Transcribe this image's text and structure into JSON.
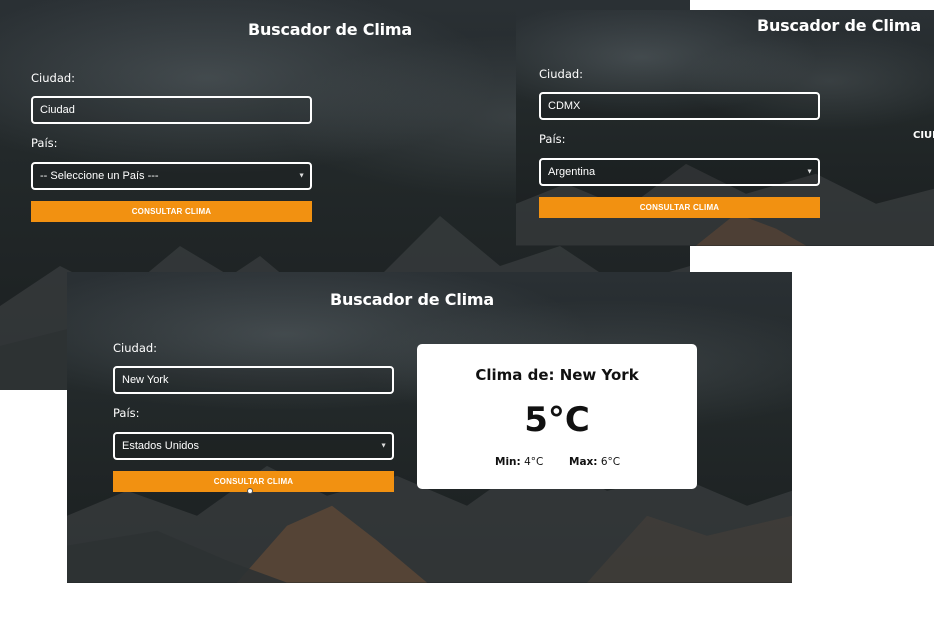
{
  "app": {
    "title": "Buscador de Clima",
    "city_label": "Ciudad:",
    "country_label": "País:",
    "button_label": "CONSULTAR CLIMA"
  },
  "screens": [
    {
      "city_value": "",
      "city_placeholder": "Ciudad",
      "country_value": "-- Seleccione un País ---"
    },
    {
      "city_value": "CDMX",
      "country_value": "Argentina",
      "cut_off_text": "CIUI"
    },
    {
      "city_value": "New York",
      "country_value": "Estados Unidos",
      "result": {
        "title": "Clima de: New York",
        "temperature": "5°C",
        "min_label": "Min:",
        "min_value": "4°C",
        "max_label": "Max:",
        "max_value": "6°C"
      }
    }
  ],
  "colors": {
    "accent": "#f29111",
    "background": "#222829",
    "text": "#ffffff",
    "card": "#ffffff"
  },
  "icons": {
    "select_arrow": "chevron-down-icon",
    "cursor": "cursor-icon"
  }
}
